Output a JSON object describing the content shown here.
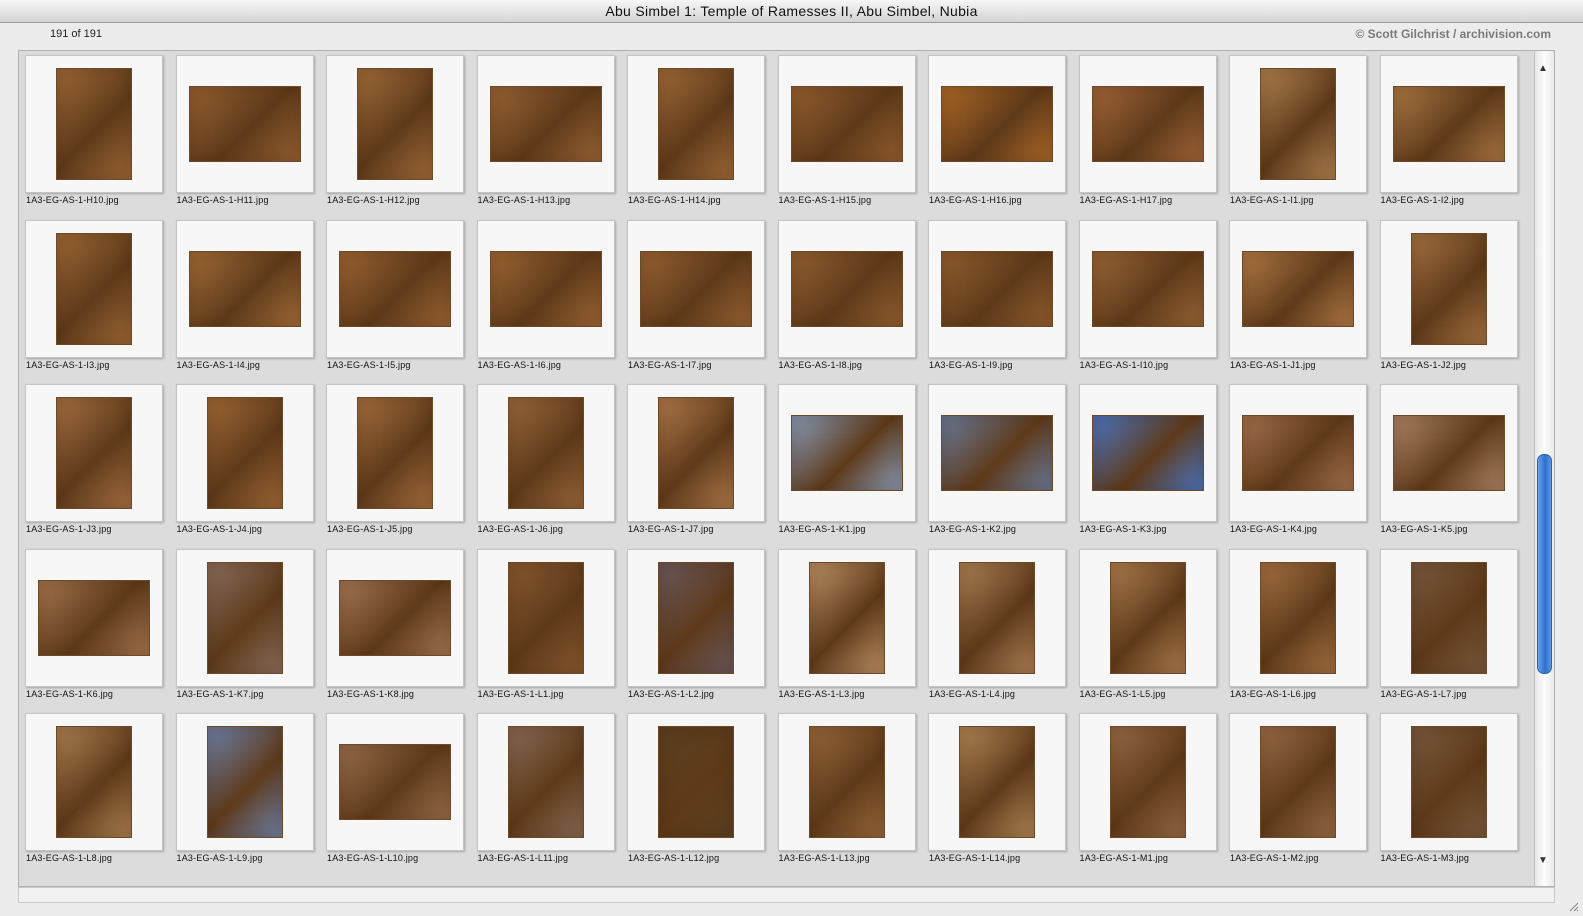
{
  "window": {
    "title": "Abu Simbel 1: Temple of Ramesses II, Abu Simbel, Nubia"
  },
  "header": {
    "counter": "191 of 191",
    "credit": "© Scott Gilchrist / archivision.com"
  },
  "scrollbar": {
    "up_arrow": "▲",
    "down_arrow": "▼"
  },
  "thumbnails": [
    {
      "label": "1A3-EG-AS-1-H10.jpg",
      "orientation": "p",
      "tone": "#a06a38"
    },
    {
      "label": "1A3-EG-AS-1-H11.jpg",
      "orientation": "l",
      "tone": "#986232"
    },
    {
      "label": "1A3-EG-AS-1-H12.jpg",
      "orientation": "p",
      "tone": "#a46e3c"
    },
    {
      "label": "1A3-EG-AS-1-H13.jpg",
      "orientation": "l",
      "tone": "#9c6636"
    },
    {
      "label": "1A3-EG-AS-1-H14.jpg",
      "orientation": "p",
      "tone": "#a26c3a"
    },
    {
      "label": "1A3-EG-AS-1-H15.jpg",
      "orientation": "l",
      "tone": "#966030"
    },
    {
      "label": "1A3-EG-AS-1-H16.jpg",
      "orientation": "l",
      "tone": "#b06a28"
    },
    {
      "label": "1A3-EG-AS-1-H17.jpg",
      "orientation": "l",
      "tone": "#a4683a"
    },
    {
      "label": "1A3-EG-AS-1-I1.jpg",
      "orientation": "p",
      "tone": "#b28452"
    },
    {
      "label": "1A3-EG-AS-1-I2.jpg",
      "orientation": "l",
      "tone": "#ae7a46"
    },
    {
      "label": "1A3-EG-AS-1-I3.jpg",
      "orientation": "p",
      "tone": "#a06a38"
    },
    {
      "label": "1A3-EG-AS-1-I4.jpg",
      "orientation": "l",
      "tone": "#a46e3a"
    },
    {
      "label": "1A3-EG-AS-1-I5.jpg",
      "orientation": "l",
      "tone": "#9e6634"
    },
    {
      "label": "1A3-EG-AS-1-I6.jpg",
      "orientation": "l",
      "tone": "#a06836"
    },
    {
      "label": "1A3-EG-AS-1-I7.jpg",
      "orientation": "l",
      "tone": "#9a6434"
    },
    {
      "label": "1A3-EG-AS-1-I8.jpg",
      "orientation": "l",
      "tone": "#966232"
    },
    {
      "label": "1A3-EG-AS-1-I9.jpg",
      "orientation": "l",
      "tone": "#946030"
    },
    {
      "label": "1A3-EG-AS-1-I10.jpg",
      "orientation": "l",
      "tone": "#9c6838"
    },
    {
      "label": "1A3-EG-AS-1-J1.jpg",
      "orientation": "l",
      "tone": "#b47c48"
    },
    {
      "label": "1A3-EG-AS-1-J2.jpg",
      "orientation": "p",
      "tone": "#a87444"
    },
    {
      "label": "1A3-EG-AS-1-J3.jpg",
      "orientation": "p",
      "tone": "#a87244"
    },
    {
      "label": "1A3-EG-AS-1-J4.jpg",
      "orientation": "p",
      "tone": "#a26a38"
    },
    {
      "label": "1A3-EG-AS-1-J5.jpg",
      "orientation": "p",
      "tone": "#a87040"
    },
    {
      "label": "1A3-EG-AS-1-J6.jpg",
      "orientation": "p",
      "tone": "#9c6a3c"
    },
    {
      "label": "1A3-EG-AS-1-J7.jpg",
      "orientation": "p",
      "tone": "#b27c4c"
    },
    {
      "label": "1A3-EG-AS-1-K1.jpg",
      "orientation": "l",
      "tone": "#8aa0c0"
    },
    {
      "label": "1A3-EG-AS-1-K2.jpg",
      "orientation": "l",
      "tone": "#6a7ea0"
    },
    {
      "label": "1A3-EG-AS-1-K3.jpg",
      "orientation": "l",
      "tone": "#4a78c8"
    },
    {
      "label": "1A3-EG-AS-1-K4.jpg",
      "orientation": "l",
      "tone": "#a87450"
    },
    {
      "label": "1A3-EG-AS-1-K5.jpg",
      "orientation": "l",
      "tone": "#b0886a"
    },
    {
      "label": "1A3-EG-AS-1-K6.jpg",
      "orientation": "l",
      "tone": "#a87850"
    },
    {
      "label": "1A3-EG-AS-1-K7.jpg",
      "orientation": "p",
      "tone": "#8a7060"
    },
    {
      "label": "1A3-EG-AS-1-K8.jpg",
      "orientation": "l",
      "tone": "#a87a58"
    },
    {
      "label": "1A3-EG-AS-1-L1.jpg",
      "orientation": "p",
      "tone": "#8a5a30"
    },
    {
      "label": "1A3-EG-AS-1-L2.jpg",
      "orientation": "p",
      "tone": "#6a5a60"
    },
    {
      "label": "1A3-EG-AS-1-L3.jpg",
      "orientation": "p",
      "tone": "#c09468"
    },
    {
      "label": "1A3-EG-AS-1-L4.jpg",
      "orientation": "p",
      "tone": "#b08458"
    },
    {
      "label": "1A3-EG-AS-1-L5.jpg",
      "orientation": "p",
      "tone": "#b08050"
    },
    {
      "label": "1A3-EG-AS-1-L6.jpg",
      "orientation": "p",
      "tone": "#a87444"
    },
    {
      "label": "1A3-EG-AS-1-L7.jpg",
      "orientation": "p",
      "tone": "#7a5a40"
    },
    {
      "label": "1A3-EG-AS-1-L8.jpg",
      "orientation": "p",
      "tone": "#b08454"
    },
    {
      "label": "1A3-EG-AS-1-L9.jpg",
      "orientation": "p",
      "tone": "#6e84b0"
    },
    {
      "label": "1A3-EG-AS-1-L10.jpg",
      "orientation": "l",
      "tone": "#9a7050"
    },
    {
      "label": "1A3-EG-AS-1-L11.jpg",
      "orientation": "p",
      "tone": "#8a6c58"
    },
    {
      "label": "1A3-EG-AS-1-L12.jpg",
      "orientation": "p",
      "tone": "#5a4020"
    },
    {
      "label": "1A3-EG-AS-1-L13.jpg",
      "orientation": "p",
      "tone": "#9a6a3c"
    },
    {
      "label": "1A3-EG-AS-1-L14.jpg",
      "orientation": "p",
      "tone": "#b48a58"
    },
    {
      "label": "1A3-EG-AS-1-M1.jpg",
      "orientation": "p",
      "tone": "#9a6c48"
    },
    {
      "label": "1A3-EG-AS-1-M2.jpg",
      "orientation": "p",
      "tone": "#9c6e48"
    },
    {
      "label": "1A3-EG-AS-1-M3.jpg",
      "orientation": "p",
      "tone": "#7a5a40"
    }
  ]
}
